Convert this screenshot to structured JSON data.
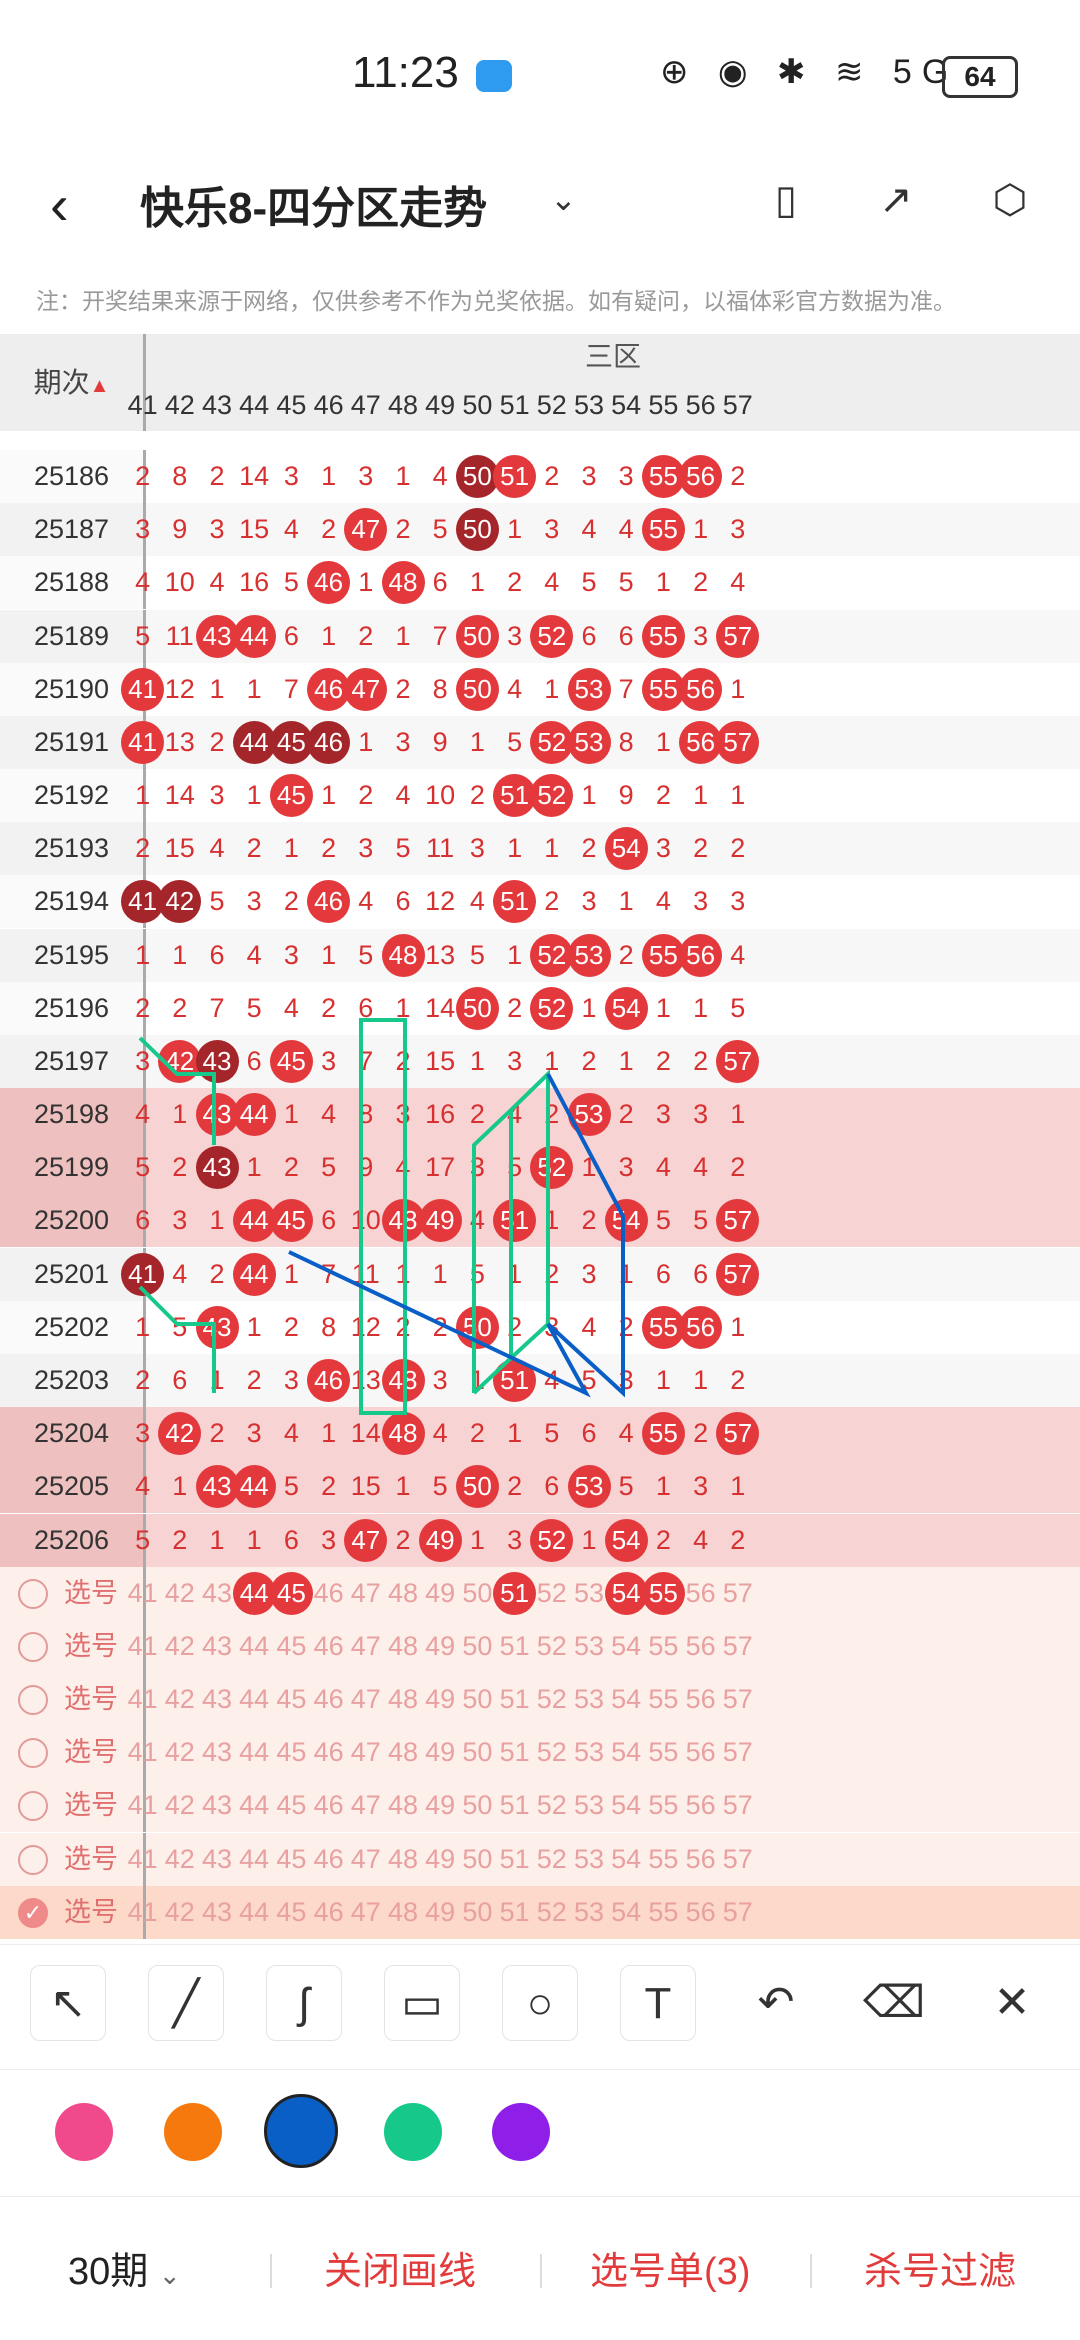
{
  "status": {
    "time": "11:23",
    "battery": "64",
    "icons": "⊕ ◉ ✱ ≋ 5G"
  },
  "header": {
    "title": "快乐8-四分区走势",
    "back_icon": "‹",
    "dropdown_icon": "⌄"
  },
  "note": "注：开奖结果来源于网络，仅供参考不作为兑奖依据。如有疑问，以福体彩官方数据为准。",
  "table": {
    "zone_label": "三区",
    "period_header": "期次",
    "columns": [
      "41",
      "42",
      "43",
      "44",
      "45",
      "46",
      "47",
      "48",
      "49",
      "50",
      "51",
      "52",
      "53",
      "54",
      "55",
      "56",
      "57"
    ],
    "rows": [
      {
        "period": "25186",
        "cells": [
          "2",
          "8",
          "2",
          "14",
          "3",
          "1",
          "3",
          "1",
          "4",
          "50",
          "51",
          "2",
          "3",
          "3",
          "55",
          "56",
          "2"
        ],
        "balls": {
          "50": "dark",
          "51": "red",
          "55": "red",
          "56": "red"
        }
      },
      {
        "period": "25187",
        "cells": [
          "3",
          "9",
          "3",
          "15",
          "4",
          "2",
          "47",
          "2",
          "5",
          "50",
          "1",
          "3",
          "4",
          "4",
          "55",
          "1",
          "3"
        ],
        "balls": {
          "47": "red",
          "50": "dark",
          "55": "red"
        }
      },
      {
        "period": "25188",
        "cells": [
          "4",
          "10",
          "4",
          "16",
          "5",
          "46",
          "1",
          "48",
          "6",
          "1",
          "2",
          "4",
          "5",
          "5",
          "1",
          "2",
          "4"
        ],
        "balls": {
          "46": "red",
          "48": "red"
        }
      },
      {
        "period": "25189",
        "cells": [
          "5",
          "11",
          "43",
          "44",
          "6",
          "1",
          "2",
          "1",
          "7",
          "50",
          "3",
          "52",
          "6",
          "6",
          "55",
          "3",
          "57"
        ],
        "balls": {
          "43": "red",
          "44": "red",
          "50": "red",
          "52": "red",
          "55": "red",
          "57": "red"
        }
      },
      {
        "period": "25190",
        "cells": [
          "41",
          "12",
          "1",
          "1",
          "7",
          "46",
          "47",
          "2",
          "8",
          "50",
          "4",
          "1",
          "53",
          "7",
          "55",
          "56",
          "1"
        ],
        "balls": {
          "41": "red",
          "46": "red",
          "47": "red",
          "50": "red",
          "53": "red",
          "55": "red",
          "56": "red"
        }
      },
      {
        "period": "25191",
        "cells": [
          "41",
          "13",
          "2",
          "44",
          "45",
          "46",
          "1",
          "3",
          "9",
          "1",
          "5",
          "52",
          "53",
          "8",
          "1",
          "56",
          "57"
        ],
        "balls": {
          "41": "red",
          "44": "dark",
          "45": "dark",
          "46": "dark",
          "52": "red",
          "53": "red",
          "56": "red",
          "57": "red"
        }
      },
      {
        "period": "25192",
        "cells": [
          "1",
          "14",
          "3",
          "1",
          "45",
          "1",
          "2",
          "4",
          "10",
          "2",
          "51",
          "52",
          "1",
          "9",
          "2",
          "1",
          "1"
        ],
        "balls": {
          "45": "red",
          "51": "red",
          "52": "red"
        }
      },
      {
        "period": "25193",
        "cells": [
          "2",
          "15",
          "4",
          "2",
          "1",
          "2",
          "3",
          "5",
          "11",
          "3",
          "1",
          "1",
          "2",
          "54",
          "3",
          "2",
          "2"
        ],
        "balls": {
          "54": "red"
        }
      },
      {
        "period": "25194",
        "cells": [
          "41",
          "42",
          "5",
          "3",
          "2",
          "46",
          "4",
          "6",
          "12",
          "4",
          "51",
          "2",
          "3",
          "1",
          "4",
          "3",
          "3"
        ],
        "balls": {
          "41": "dark",
          "42": "dark",
          "46": "red",
          "51": "red"
        }
      },
      {
        "period": "25195",
        "cells": [
          "1",
          "1",
          "6",
          "4",
          "3",
          "1",
          "5",
          "48",
          "13",
          "5",
          "1",
          "52",
          "53",
          "2",
          "55",
          "56",
          "4"
        ],
        "balls": {
          "48": "red",
          "52": "red",
          "53": "red",
          "55": "red",
          "56": "red"
        }
      },
      {
        "period": "25196",
        "cells": [
          "2",
          "2",
          "7",
          "5",
          "4",
          "2",
          "6",
          "1",
          "14",
          "50",
          "2",
          "52",
          "1",
          "54",
          "1",
          "1",
          "5"
        ],
        "balls": {
          "50": "red",
          "52": "red",
          "54": "red"
        }
      },
      {
        "period": "25197",
        "cells": [
          "3",
          "42",
          "43",
          "6",
          "45",
          "3",
          "7",
          "2",
          "15",
          "1",
          "3",
          "1",
          "2",
          "1",
          "2",
          "2",
          "57"
        ],
        "balls": {
          "42": "red",
          "43": "dark",
          "45": "red",
          "57": "red"
        }
      },
      {
        "period": "25198",
        "cells": [
          "4",
          "1",
          "43",
          "44",
          "1",
          "4",
          "8",
          "3",
          "16",
          "2",
          "4",
          "2",
          "53",
          "2",
          "3",
          "3",
          "1"
        ],
        "balls": {
          "43": "red",
          "44": "red",
          "53": "red"
        },
        "shade": "pink"
      },
      {
        "period": "25199",
        "cells": [
          "5",
          "2",
          "43",
          "1",
          "2",
          "5",
          "9",
          "4",
          "17",
          "3",
          "5",
          "52",
          "1",
          "3",
          "4",
          "4",
          "2"
        ],
        "balls": {
          "43": "dark",
          "52": "red"
        },
        "shade": "pink"
      },
      {
        "period": "25200",
        "cells": [
          "6",
          "3",
          "1",
          "44",
          "45",
          "6",
          "10",
          "48",
          "49",
          "4",
          "51",
          "1",
          "2",
          "54",
          "5",
          "5",
          "57"
        ],
        "balls": {
          "44": "red",
          "45": "red",
          "48": "red",
          "49": "red",
          "51": "red",
          "54": "red",
          "57": "red"
        },
        "shade": "pink"
      },
      {
        "period": "25201",
        "cells": [
          "41",
          "4",
          "2",
          "44",
          "1",
          "7",
          "11",
          "1",
          "1",
          "5",
          "1",
          "2",
          "3",
          "1",
          "6",
          "6",
          "57"
        ],
        "balls": {
          "41": "dark",
          "44": "red",
          "57": "red"
        }
      },
      {
        "period": "25202",
        "cells": [
          "1",
          "5",
          "43",
          "1",
          "2",
          "8",
          "12",
          "2",
          "2",
          "50",
          "2",
          "3",
          "4",
          "2",
          "55",
          "56",
          "1"
        ],
        "balls": {
          "43": "red",
          "50": "red",
          "55": "red",
          "56": "red"
        }
      },
      {
        "period": "25203",
        "cells": [
          "2",
          "6",
          "1",
          "2",
          "3",
          "46",
          "13",
          "48",
          "3",
          "1",
          "51",
          "4",
          "5",
          "3",
          "1",
          "1",
          "2"
        ],
        "balls": {
          "46": "red",
          "48": "red",
          "51": "red"
        }
      },
      {
        "period": "25204",
        "cells": [
          "3",
          "42",
          "2",
          "3",
          "4",
          "1",
          "14",
          "48",
          "4",
          "2",
          "1",
          "5",
          "6",
          "4",
          "55",
          "2",
          "57"
        ],
        "balls": {
          "42": "red",
          "48": "red",
          "55": "red",
          "57": "red"
        },
        "shade": "pink"
      },
      {
        "period": "25205",
        "cells": [
          "4",
          "1",
          "43",
          "44",
          "5",
          "2",
          "15",
          "1",
          "5",
          "50",
          "2",
          "6",
          "53",
          "5",
          "1",
          "3",
          "1"
        ],
        "balls": {
          "43": "red",
          "44": "red",
          "50": "red",
          "53": "red"
        },
        "shade": "pink"
      },
      {
        "period": "25206",
        "cells": [
          "5",
          "2",
          "1",
          "1",
          "6",
          "3",
          "47",
          "2",
          "49",
          "1",
          "3",
          "52",
          "1",
          "54",
          "2",
          "4",
          "2"
        ],
        "balls": {
          "47": "red",
          "49": "red",
          "52": "red",
          "54": "red"
        },
        "shade": "pink"
      }
    ],
    "select_label": "选号",
    "select_rows": [
      {
        "balls": {
          "44": "red",
          "45": "red",
          "51": "red",
          "54": "red",
          "55": "red"
        },
        "checked": false
      },
      {
        "balls": {},
        "checked": false
      },
      {
        "balls": {},
        "checked": false
      },
      {
        "balls": {},
        "checked": false
      },
      {
        "balls": {},
        "checked": false
      },
      {
        "balls": {},
        "checked": false
      },
      {
        "balls": {},
        "checked": true
      }
    ]
  },
  "tools": [
    {
      "name": "arrow-tool",
      "glyph": "↖"
    },
    {
      "name": "line-tool",
      "glyph": "╱"
    },
    {
      "name": "curve-tool",
      "glyph": "ʃ"
    },
    {
      "name": "rectangle-tool",
      "glyph": "▭"
    },
    {
      "name": "circle-tool",
      "glyph": "○"
    },
    {
      "name": "text-tool",
      "glyph": "T"
    },
    {
      "name": "undo-tool",
      "glyph": "↶"
    },
    {
      "name": "eraser-tool",
      "glyph": "⌫"
    },
    {
      "name": "clear-tool",
      "glyph": "✕"
    }
  ],
  "palette": [
    "#f04a8c",
    "#f6790d",
    "#0a5fc6",
    "#16c98a",
    "#8f1fe8"
  ],
  "selected_color": "#0a5fc6",
  "bottom": {
    "period_select": "30期",
    "close_lines": "关闭画线",
    "pick_list": "选号单(3)",
    "kill_filter": "杀号过滤"
  }
}
